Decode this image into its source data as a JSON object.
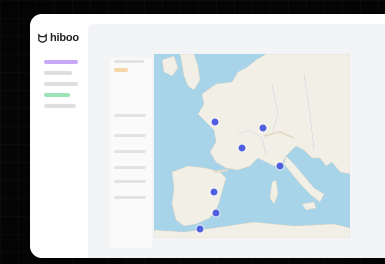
{
  "app": {
    "logo_text": "hiboo"
  },
  "theme": {
    "accent": "#c9a9f7",
    "green": "#9ee3b8",
    "orange": "#f6d5a8",
    "pin": "#4f5fe0",
    "sea": "#a8d4ea",
    "land": "#f2efe6"
  },
  "sidebar": {
    "items": [
      "nav-item-purple",
      "nav-item-1",
      "nav-item-2",
      "nav-item-green",
      "nav-item-3"
    ]
  },
  "map": {
    "pins": [
      {
        "name": "france-north"
      },
      {
        "name": "france-west"
      },
      {
        "name": "france-center"
      },
      {
        "name": "france-south"
      },
      {
        "name": "spain-north"
      },
      {
        "name": "spain-center"
      },
      {
        "name": "spain-south"
      }
    ]
  }
}
